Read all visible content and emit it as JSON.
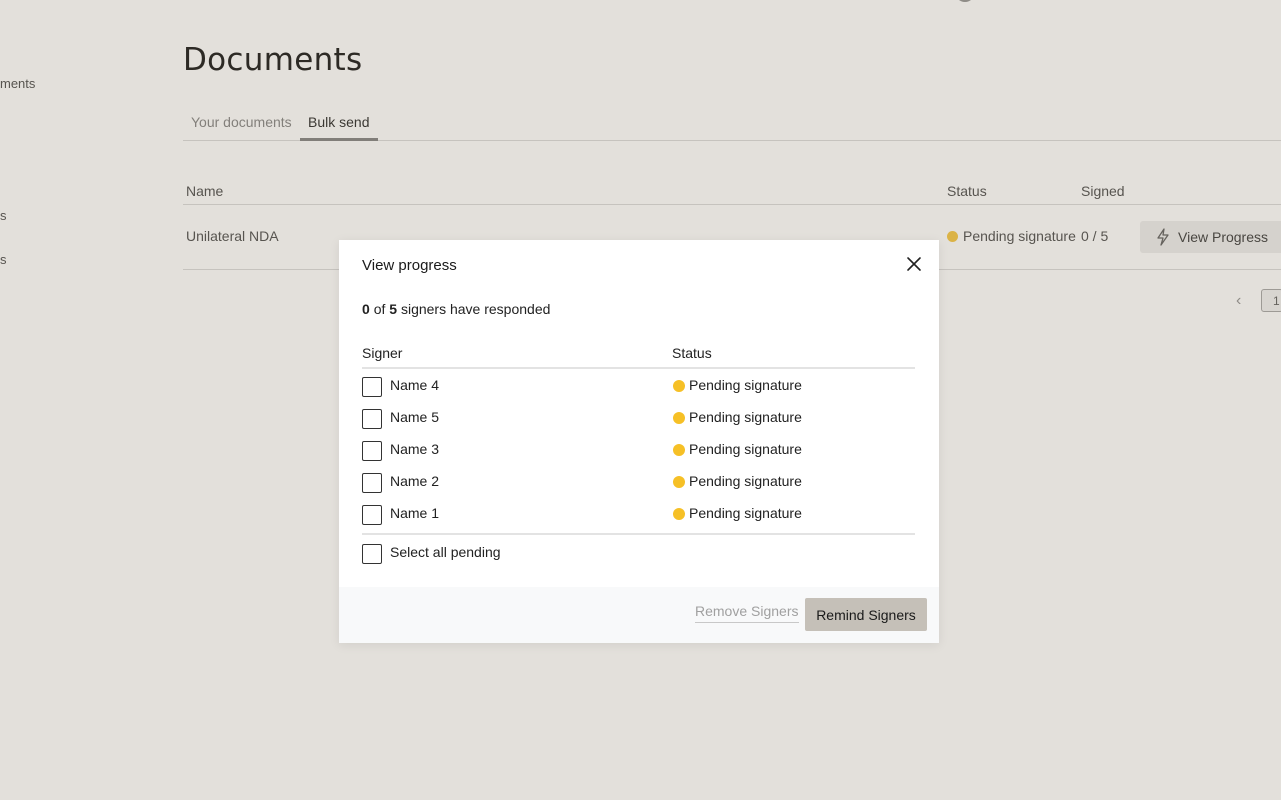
{
  "sidebar": {
    "fragments": [
      "ments",
      "s",
      "s"
    ]
  },
  "page": {
    "title": "Documents",
    "tabs": [
      {
        "label": "Your documents"
      },
      {
        "label": "Bulk send"
      }
    ],
    "table": {
      "headers": {
        "name": "Name",
        "status": "Status",
        "signed": "Signed"
      },
      "rows": [
        {
          "name": "Unilateral NDA",
          "status": "Pending signature",
          "signed": "0 / 5",
          "action": "View Progress"
        }
      ]
    },
    "pagination": {
      "current_page": "1"
    }
  },
  "modal": {
    "title": "View progress",
    "summary": {
      "responded": "0",
      "of": "of",
      "total": "5",
      "suffix": "signers have responded"
    },
    "columns": {
      "signer": "Signer",
      "status": "Status"
    },
    "signers": [
      {
        "name": "Name 4",
        "status": "Pending signature"
      },
      {
        "name": "Name 5",
        "status": "Pending signature"
      },
      {
        "name": "Name 3",
        "status": "Pending signature"
      },
      {
        "name": "Name 2",
        "status": "Pending signature"
      },
      {
        "name": "Name 1",
        "status": "Pending signature"
      }
    ],
    "select_all_label": "Select all pending",
    "buttons": {
      "remove": "Remove Signers",
      "remind": "Remind Signers"
    }
  },
  "colors": {
    "pending": "#f6c026",
    "overlay": "#e4e1db",
    "remind_button": "#c5c0b8"
  },
  "icons": {
    "close": "close-icon",
    "bolt": "lightning-icon",
    "chevron": "chevron-left-icon"
  }
}
